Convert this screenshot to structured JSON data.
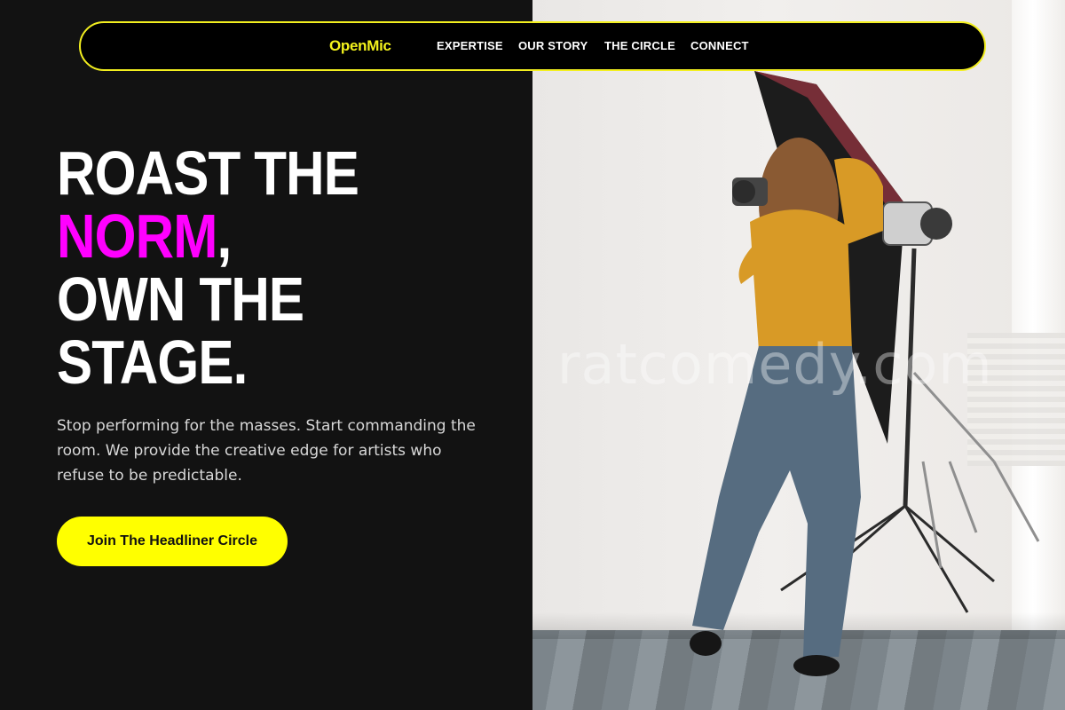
{
  "nav": {
    "logo": "OpenMic",
    "links": [
      "EXPERTISE",
      "OUR STORY",
      "THE CIRCLE",
      "CONNECT"
    ]
  },
  "hero": {
    "line1": "ROAST THE",
    "accent_word": "NORM",
    "accent_punct": ",",
    "line3": "OWN THE",
    "line4": "STAGE.",
    "subcopy": "Stop performing for the masses. Start commanding the room. We provide the creative edge for artists who refuse to be predictable.",
    "cta_label": "Join The Headliner Circle"
  },
  "watermark": "ratcomedy.com",
  "colors": {
    "background": "#121212",
    "accent_yellow": "#ffff00",
    "accent_magenta": "#ff00ff",
    "text": "#ffffff"
  }
}
